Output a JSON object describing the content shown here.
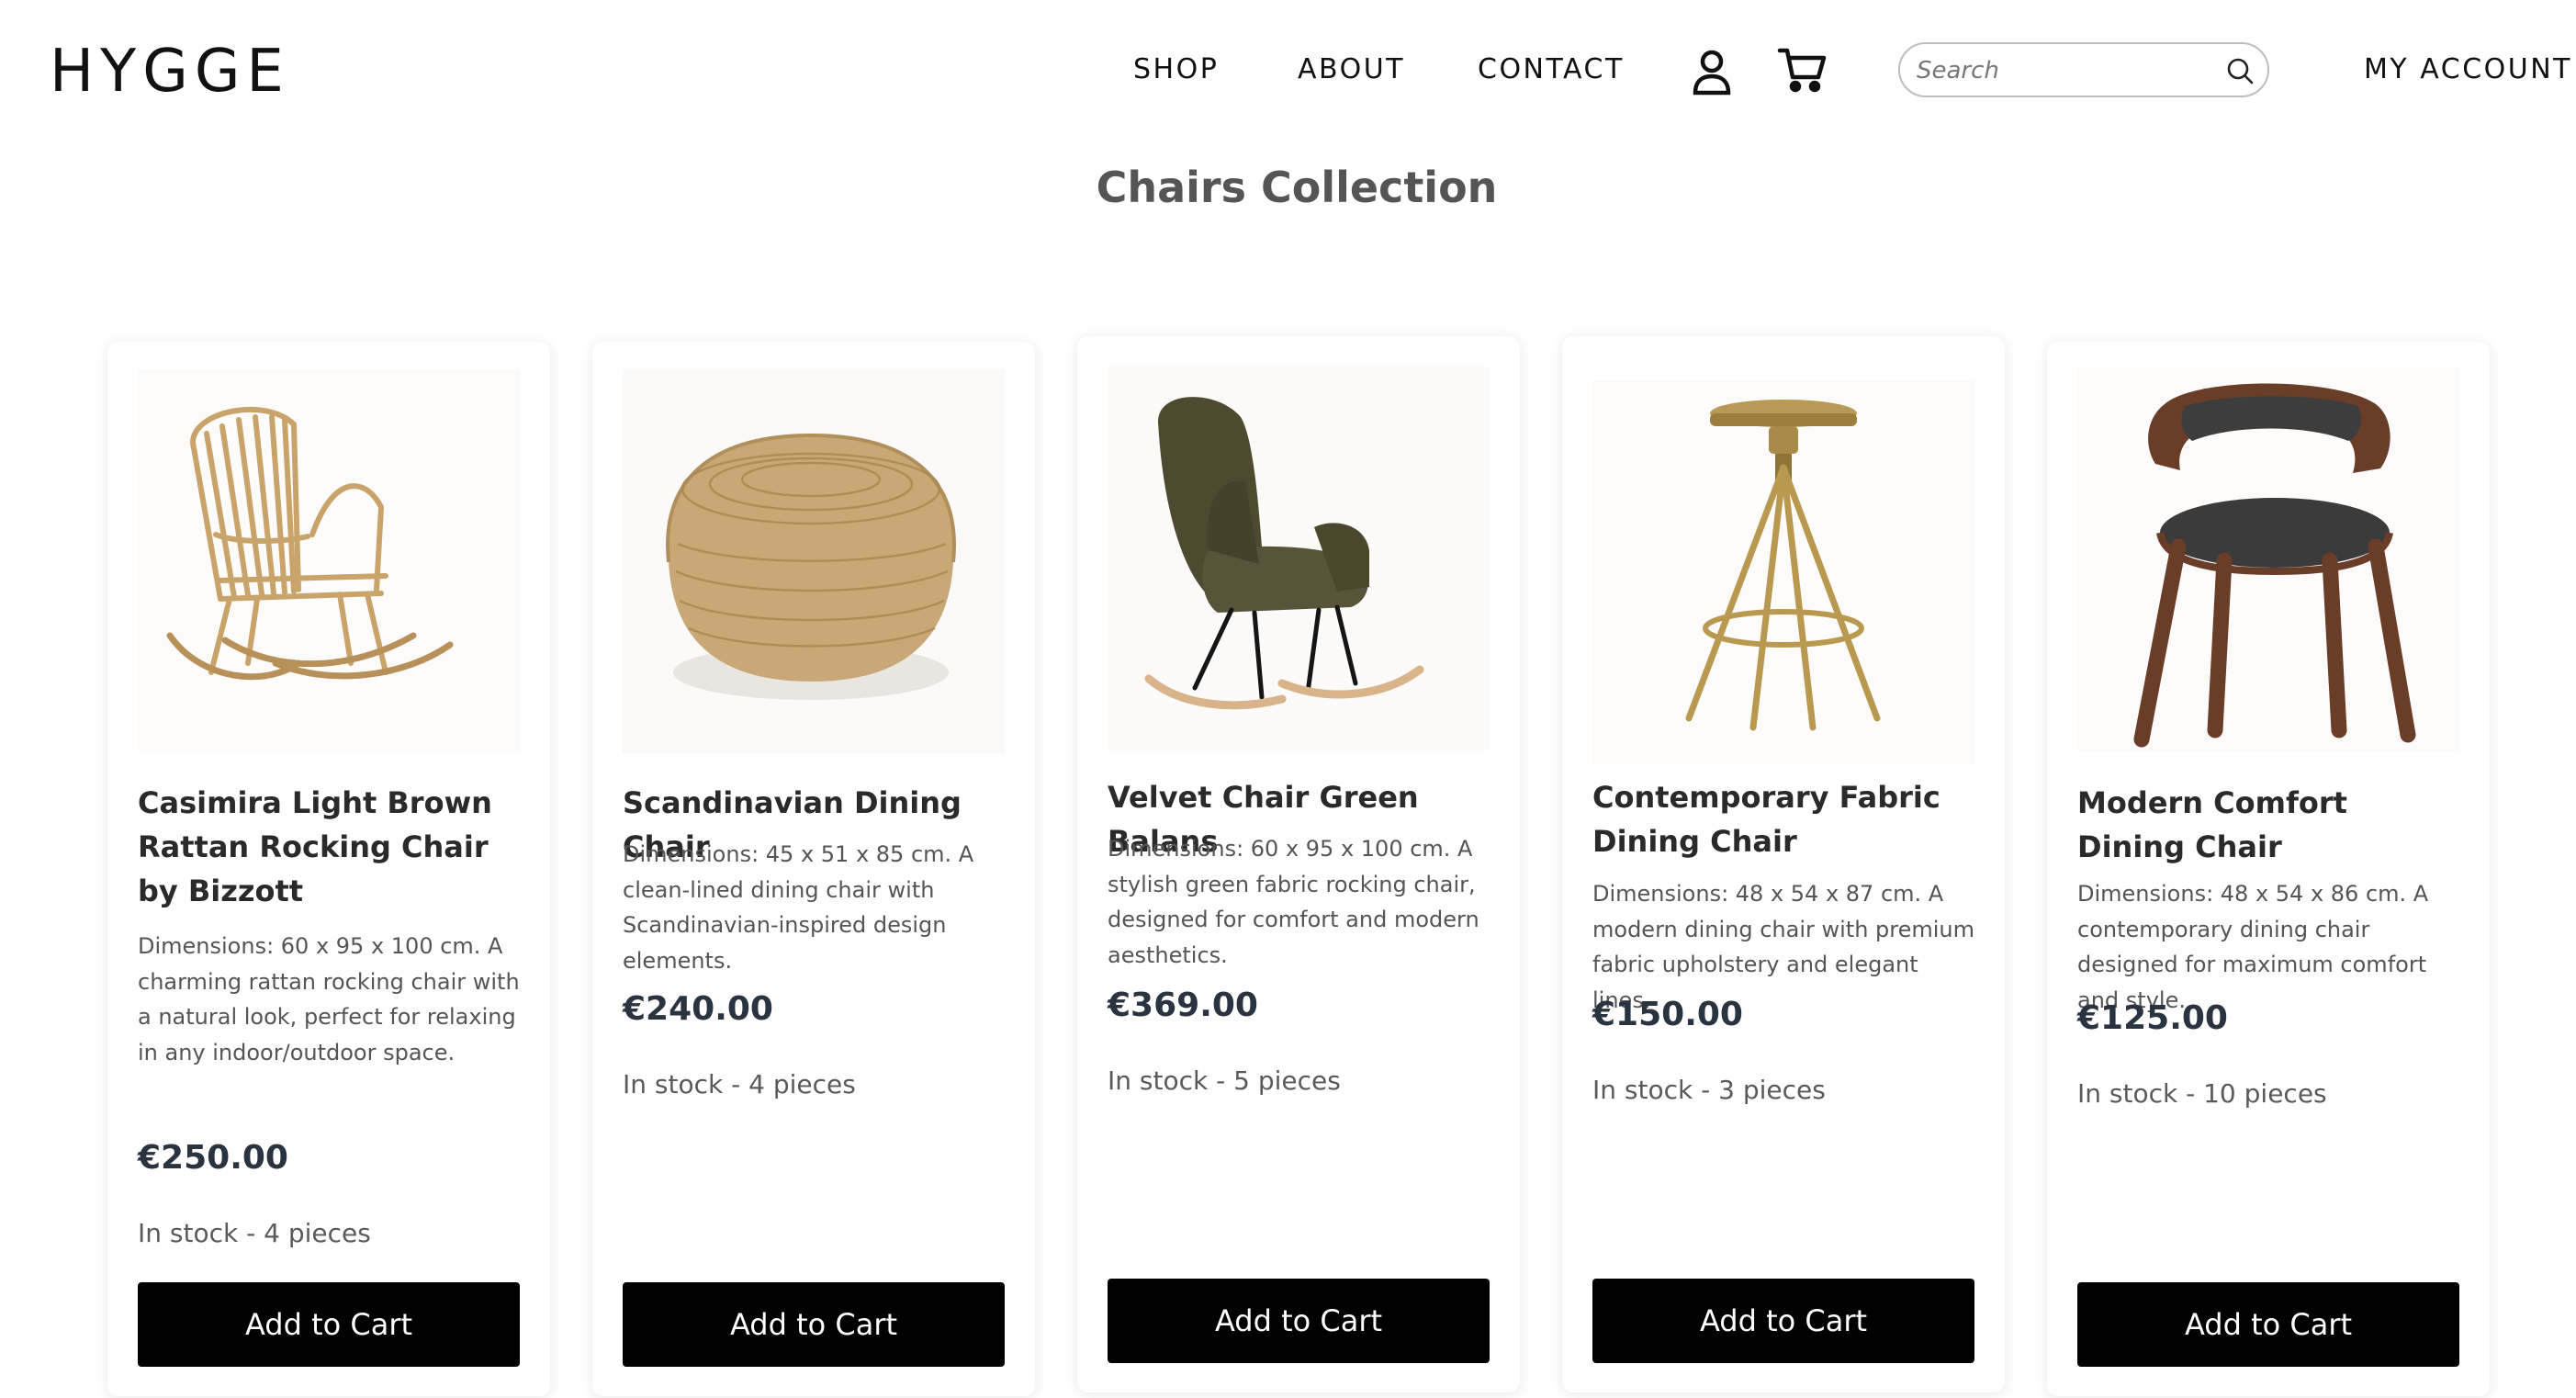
{
  "header": {
    "logo": "HYGGE",
    "nav": {
      "shop": "SHOP",
      "about": "ABOUT",
      "contact": "CONTACT",
      "my_account": "MY ACCOUNT"
    },
    "icons": [
      "user-icon",
      "cart-icon",
      "search-icon"
    ],
    "search": {
      "placeholder": "Search",
      "value": ""
    }
  },
  "main": {
    "title": "Chairs Collection",
    "products": [
      {
        "name": "Casimira Light Brown Rattan Rocking Chair by Bizzott",
        "image": "rattan-rocking-chair",
        "description": "Dimensions: 60 x 95 x 100 cm. A charming rattan rocking chair with a natural look, perfect for relaxing in any indoor/outdoor space.",
        "price": "€250.00",
        "stock": "In stock - 4 pieces",
        "button": "Add to Cart"
      },
      {
        "name": "Scandinavian Dining Chair",
        "image": "jute-pouf",
        "description": "Dimensions: 45 x 51 x 85 cm. A clean-lined dining chair with Scandinavian-inspired design elements.",
        "price": "€240.00",
        "stock": "In stock - 4 pieces",
        "button": "Add to Cart"
      },
      {
        "name": "Velvet Chair Green Balans",
        "image": "green-rocking-chair",
        "description": "Dimensions: 60 x 95 x 100 cm. A stylish green fabric rocking chair, designed for comfort and modern aesthetics.",
        "price": "€369.00",
        "stock": "In stock - 5 pieces",
        "button": "Add to Cart"
      },
      {
        "name": "Contemporary Fabric Dining Chair",
        "image": "brass-bar-stool",
        "description": "Dimensions: 48 x 54 x 87 cm. A modern dining chair with premium fabric upholstery and elegant lines.",
        "price": "€150.00",
        "stock": "In stock - 3 pieces",
        "button": "Add to Cart"
      },
      {
        "name": "Modern Comfort Dining Chair",
        "image": "walnut-dining-chair",
        "description": "Dimensions: 48 x 54 x 86 cm. A contemporary dining chair designed for maximum comfort and style.",
        "price": "€125.00",
        "stock": "In stock - 10 pieces",
        "button": "Add to Cart"
      }
    ]
  }
}
